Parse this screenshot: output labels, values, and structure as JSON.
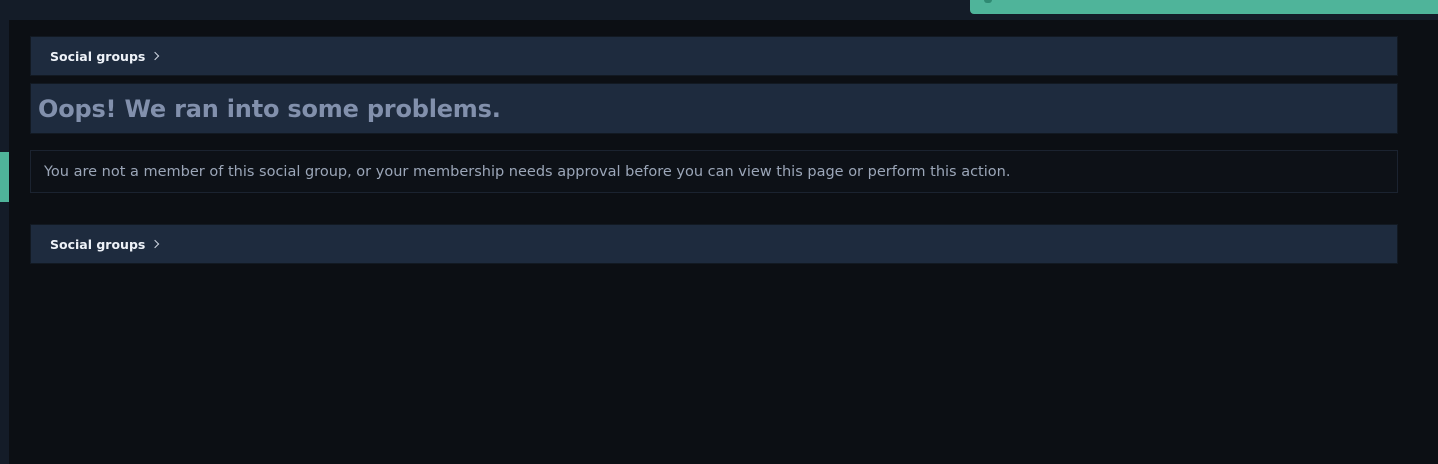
{
  "breadcrumb_top": {
    "label": "Social groups"
  },
  "page_title": "Oops! We ran into some problems.",
  "error_message": "You are not a member of this social group, or your membership needs approval before you can view this page or perform this action.",
  "breadcrumb_bottom": {
    "label": "Social groups"
  },
  "colors": {
    "background": "#0c0f14",
    "panel": "#1e2b3e",
    "accent": "#4fb49a",
    "title_text": "#8290ac",
    "body_text": "#9ba6b8"
  },
  "icons": {
    "breadcrumb_separator": "chevron-right-icon"
  }
}
